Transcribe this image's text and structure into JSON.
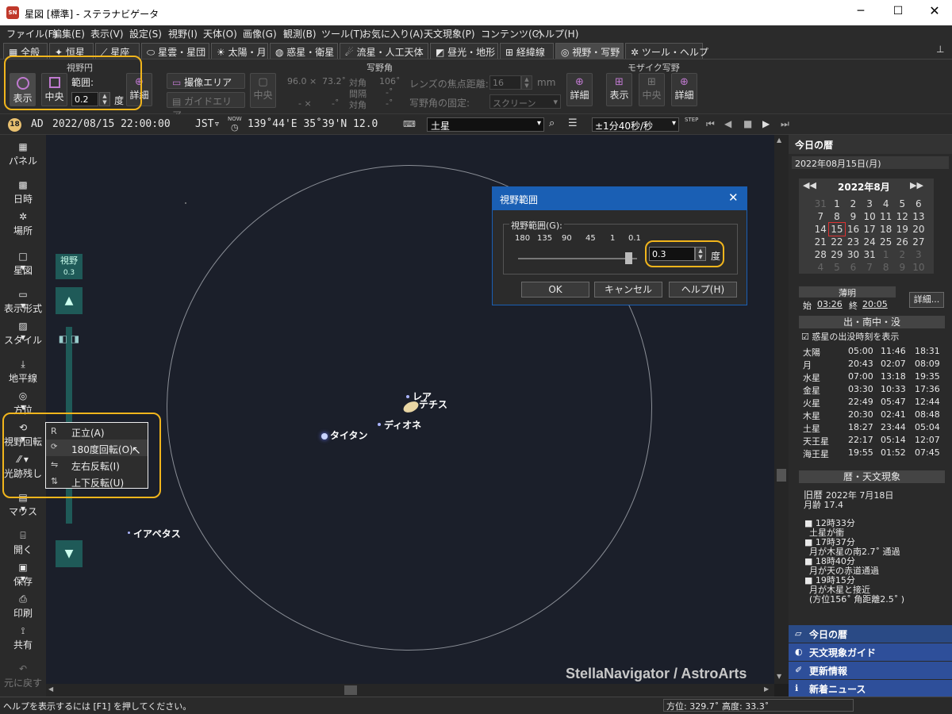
{
  "window": {
    "title": "星図 [標準] - ステラナビゲータ",
    "app_icon": "SN"
  },
  "menu": [
    "ファイル(F)",
    "編集(E)",
    "表示(V)",
    "設定(S)",
    "視野(I)",
    "天体(O)",
    "画像(G)",
    "観測(B)",
    "ツール(T)",
    "お気に入り(A)",
    "天文現象(P)",
    "コンテンツ(C)",
    "ヘルプ(H)"
  ],
  "tabs": [
    "全般",
    "恒星",
    "星座",
    "星雲・星団",
    "太陽・月",
    "惑星・衛星",
    "流星・人工天体",
    "昼光・地形",
    "経緯線",
    "視野・写野",
    "ツール・ヘルプ"
  ],
  "ribbon": {
    "fov_group": "視野円",
    "show": "表示",
    "center": "中央",
    "range_label": "範囲:",
    "range_value": "0.2",
    "deg": "度",
    "detail": "詳細",
    "photo_group": "写野角",
    "imaging_area": "撮像エリア",
    "guide_area": "ガイドエリア",
    "photo_center": "中央",
    "fov_w": "96.0 ×",
    "fov_h": "73.2˚",
    "diag_label": "対角",
    "diag_value": "106˚",
    "interval_label": "間隔",
    "interval_value": "-˚",
    "x_dash": "- ×",
    "y_dash": "-˚",
    "diag_label2": "対角",
    "diag_value2": "-˚",
    "focal_label": "レンズの焦点距離:",
    "focal_value": "16",
    "mm": "mm",
    "fix_label": "写野角の固定:",
    "fix_value": "スクリーン",
    "photo_detail": "詳細",
    "mosaic_group": "モザイク写野",
    "m_show": "表示",
    "m_center": "中央",
    "m_detail": "詳細"
  },
  "statusrow": {
    "badge": "18",
    "era": "AD",
    "datetime": "2022/08/15 22:00:00",
    "tz": "JST▿",
    "now": "NOW",
    "coords": "139˚44'E 35˚39'N 12.0",
    "target": "土星",
    "speed": "±1分40秒/秒",
    "step": "STEP"
  },
  "lefttool": [
    "パネル",
    "日時",
    "場所",
    "星図",
    "表示形式",
    "スタイル",
    "地平線",
    "方位",
    "視野回転",
    "光跡残し",
    "マウス",
    "開く",
    "保存",
    "印刷",
    "共有",
    "元に戻す"
  ],
  "fov_indicator": {
    "label": "視野",
    "value": "0.3"
  },
  "context_menu": [
    "正立(A)",
    "180度回転(O)",
    "左右反転(I)",
    "上下反転(U)"
  ],
  "sky_labels": {
    "rhea": "レア",
    "tethys": "テチス",
    "dione": "ディオネ",
    "titan": "タイタン",
    "iapetus": "イアペタス",
    "watermark": "StellaNavigator / AstroArts"
  },
  "dialog": {
    "title": "視野範囲",
    "group": "視野範囲(G):",
    "scale": [
      "180",
      "135",
      "90",
      "45",
      "1",
      "0.1"
    ],
    "value": "0.3",
    "deg": "度",
    "ok": "OK",
    "cancel": "キャンセル",
    "help": "ヘルプ(H)"
  },
  "right": {
    "header": "今日の暦",
    "date": "2022年08月15日(月)",
    "month": "2022年8月",
    "weeks": [
      [
        "31",
        "1",
        "2",
        "3",
        "4",
        "5",
        "6"
      ],
      [
        "7",
        "8",
        "9",
        "10",
        "11",
        "12",
        "13"
      ],
      [
        "14",
        "15",
        "16",
        "17",
        "18",
        "19",
        "20"
      ],
      [
        "21",
        "22",
        "23",
        "24",
        "25",
        "26",
        "27"
      ],
      [
        "28",
        "29",
        "30",
        "31",
        "1",
        "2",
        "3"
      ],
      [
        "4",
        "5",
        "6",
        "7",
        "8",
        "9",
        "10"
      ]
    ],
    "twilight": "薄明",
    "start_label": "始",
    "start": "03:26",
    "end_label": "終",
    "end": "20:05",
    "detail": "詳細...",
    "rise_header": "出・南中・没",
    "show_planets": "惑星の出没時刻を表示",
    "rise": [
      [
        "太陽",
        "05:00",
        "11:46",
        "18:31"
      ],
      [
        "月",
        "20:43",
        "02:07",
        "08:09"
      ],
      [
        "水星",
        "07:00",
        "13:18",
        "19:35"
      ],
      [
        "金星",
        "03:30",
        "10:33",
        "17:36"
      ],
      [
        "火星",
        "22:49",
        "05:47",
        "12:44"
      ],
      [
        "木星",
        "20:30",
        "02:41",
        "08:48"
      ],
      [
        "土星",
        "18:27",
        "23:44",
        "05:04"
      ],
      [
        "天王星",
        "22:17",
        "05:14",
        "12:07"
      ],
      [
        "海王星",
        "19:55",
        "01:52",
        "07:45"
      ]
    ],
    "cal_header": "暦・天文現象",
    "kyureki_label": "旧暦",
    "kyureki": "2022年 7月18日",
    "moonage_label": "月齢",
    "moonage": "17.4",
    "events": [
      [
        "12時33分",
        "土星が衝"
      ],
      [
        "17時37分",
        "月が木星の南2.7˚ 通過"
      ],
      [
        "18時40分",
        "月が天の赤道通過"
      ],
      [
        "19時15分",
        "月が木星と接近"
      ]
    ],
    "event_extra": "(方位156˚ 角距離2.5˚ )",
    "nav": [
      "今日の暦",
      "天文現象ガイド",
      "更新情報",
      "新着ニュース"
    ]
  },
  "status": {
    "help": "ヘルプを表示するには [F1] を押してください。",
    "azimuth": "方位: 329.7˚",
    "altitude": "高度: 33.3˚"
  },
  "colors": {
    "accent": "#f1b51c",
    "sky": "#1b1f2a",
    "dialog_title": "#1a5fb4"
  }
}
